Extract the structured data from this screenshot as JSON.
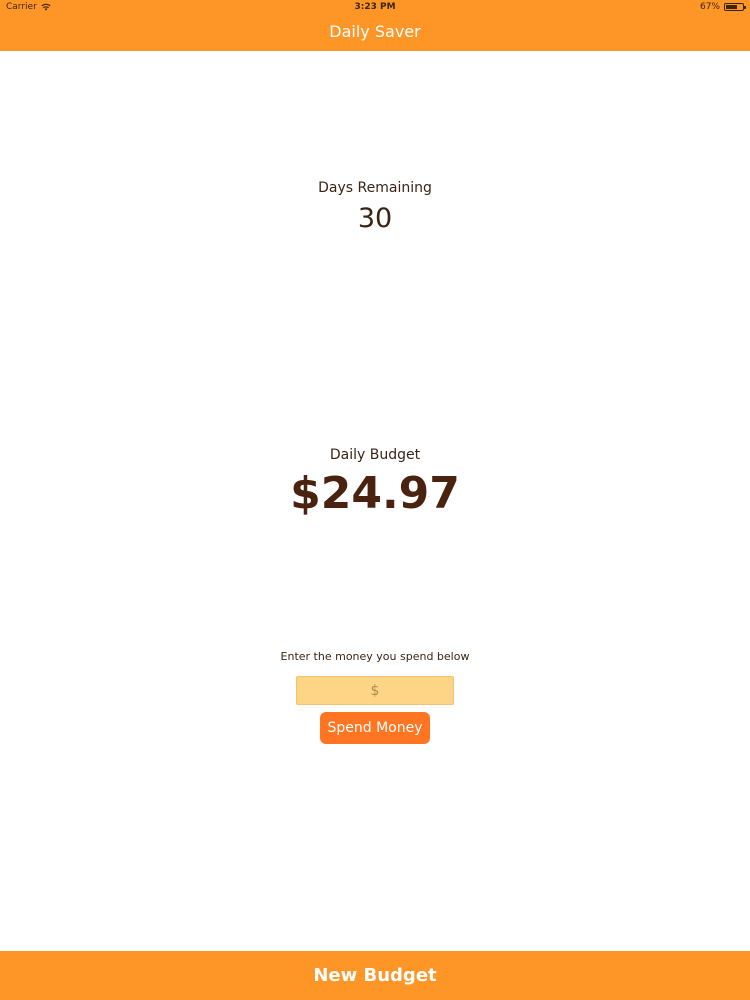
{
  "status_bar": {
    "carrier": "Carrier",
    "time": "3:23 PM",
    "battery": "67%",
    "battery_level": 0.67
  },
  "nav": {
    "title": "Daily Saver"
  },
  "days_remaining": {
    "label": "Days Remaining",
    "value": "30"
  },
  "daily_budget": {
    "label": "Daily Budget",
    "value": "$24.97"
  },
  "spend": {
    "prompt": "Enter the money you spend below",
    "placeholder": "$",
    "button_label": "Spend Money"
  },
  "footer": {
    "new_budget_label": "New Budget"
  },
  "colors": {
    "accent": "#fd9627",
    "input_background": "#fed486",
    "button": "#ff7522",
    "text": "#3b2414"
  },
  "icons": {
    "wifi": "wifi-icon",
    "battery": "battery-icon"
  }
}
